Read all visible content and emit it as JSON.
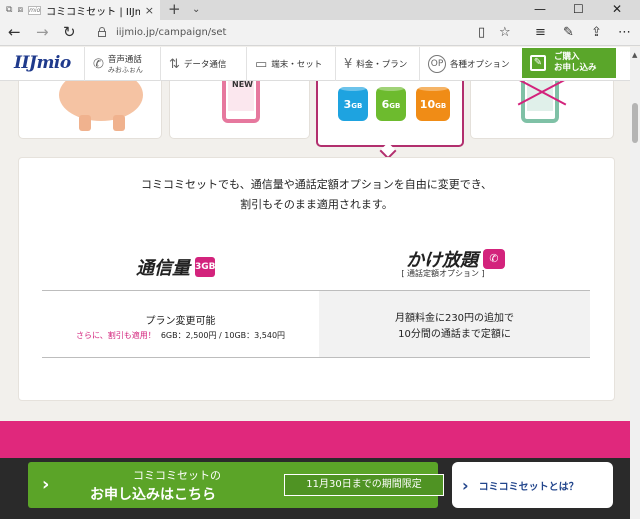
{
  "browser": {
    "tab_title": "コミコミセット | IIJmio",
    "tab_favicon": "mio",
    "url": "iijmio.jp/campaign/set",
    "icons": [
      "back-icon",
      "forward-icon",
      "refresh-icon",
      "lock-icon",
      "reading-view-icon",
      "favorite-star-icon",
      "hub-icon",
      "web-note-icon",
      "share-icon",
      "more-icon"
    ]
  },
  "header": {
    "logo": "IIJmio",
    "nav": [
      {
        "label": "音声通話",
        "sub": "みおふぉん",
        "icon": "phone-icon"
      },
      {
        "label": "データ通信",
        "icon": "data-arrows-icon"
      },
      {
        "label": "端末・セット",
        "icon": "device-icon"
      },
      {
        "label": "料金・プラン",
        "icon": "yen-icon"
      },
      {
        "label": "各種オプション",
        "icon": "options-icon"
      }
    ],
    "apply": {
      "line1": "ご購入",
      "line2": "お申し込み",
      "icon": "edit-icon"
    }
  },
  "cards": {
    "new_label": "NEW",
    "capacities": [
      {
        "num": "3",
        "unit": "GB",
        "color": "#1ea3e0"
      },
      {
        "num": "6",
        "unit": "GB",
        "color": "#6dbb2e"
      },
      {
        "num": "10",
        "unit": "GB",
        "color": "#f08c16"
      }
    ]
  },
  "panel": {
    "intro_line1": "コミコミセットでも、通信量や通話定額オプションを自由に変更でき、",
    "intro_line2": "割引もそのまま適用されます。",
    "left_title": "通信量",
    "left_badge": "3GB",
    "right_title": "かけ放題",
    "right_sub": "[ 通話定額オプション ]",
    "left_main": "プラン変更可能",
    "left_note": "さらに、割引も適用！",
    "left_prices": "6GB：2,500円 / 10GB：3,540円",
    "right_line1": "月額料金に230円の追加で",
    "right_line2": "10分間の通話まで定額に"
  },
  "footer": {
    "cta_line1": "コミコミセットの",
    "cta_line2": "お申し込みはこちら",
    "cta_period": "11月30日までの期間限定",
    "about_label": "コミコミセットとは？"
  },
  "colors": {
    "brand_blue": "#1f3a8c",
    "accent_pink": "#d3237c",
    "cta_green": "#5ba428"
  }
}
